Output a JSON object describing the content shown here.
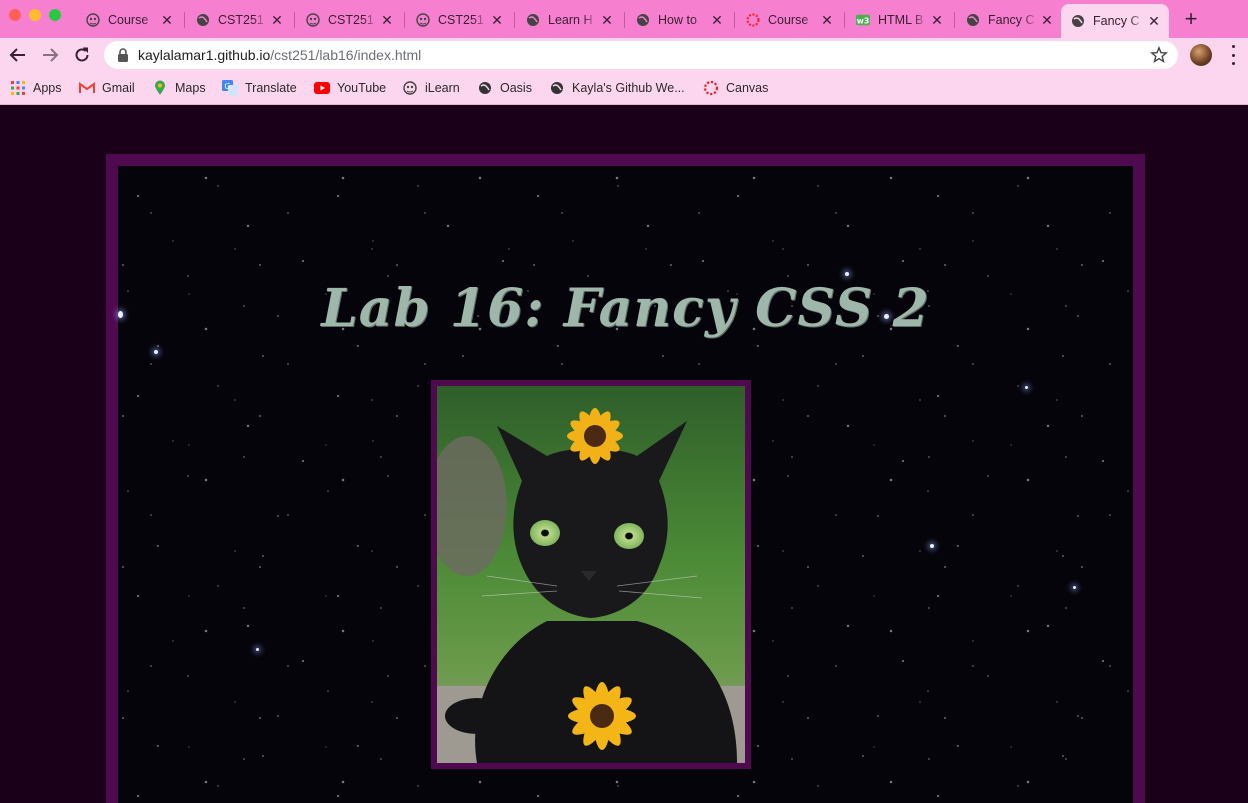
{
  "browser": {
    "tabs": [
      {
        "title": "Course",
        "icon": "eagle-icon"
      },
      {
        "title": "CST251",
        "icon": "globe-icon"
      },
      {
        "title": "CST251",
        "icon": "eagle-icon"
      },
      {
        "title": "CST251",
        "icon": "eagle-icon"
      },
      {
        "title": "Learn H",
        "icon": "globe-icon"
      },
      {
        "title": "How to",
        "icon": "globe-icon"
      },
      {
        "title": "Course",
        "icon": "canvas-icon"
      },
      {
        "title": "HTML B",
        "icon": "w3-icon"
      },
      {
        "title": "Fancy C",
        "icon": "globe-icon"
      },
      {
        "title": "Fancy C",
        "icon": "globe-icon",
        "active": true
      }
    ],
    "url": {
      "host": "kaylalamar1.github.io",
      "path": "/cst251/lab16/index.html"
    },
    "bookmarks": [
      {
        "label": "Apps",
        "icon": "apps-grid-icon"
      },
      {
        "label": "Gmail",
        "icon": "gmail-icon"
      },
      {
        "label": "Maps",
        "icon": "maps-pin-icon"
      },
      {
        "label": "Translate",
        "icon": "translate-icon"
      },
      {
        "label": "YouTube",
        "icon": "youtube-icon"
      },
      {
        "label": "iLearn",
        "icon": "eagle-icon"
      },
      {
        "label": "Oasis",
        "icon": "globe-icon"
      },
      {
        "label": "Kayla's Github We...",
        "icon": "globe-icon"
      },
      {
        "label": "Canvas",
        "icon": "canvas-icon"
      }
    ],
    "colors": {
      "tabbar": "#f77fd0",
      "toolbar": "#fcd6ee"
    }
  },
  "page": {
    "title": "Lab 16: Fancy CSS 2",
    "image": "black cat with yellow flowers",
    "colors": {
      "background": "#1a0019",
      "frame": "#4f0a4f",
      "title": "#9fb6aa"
    }
  }
}
